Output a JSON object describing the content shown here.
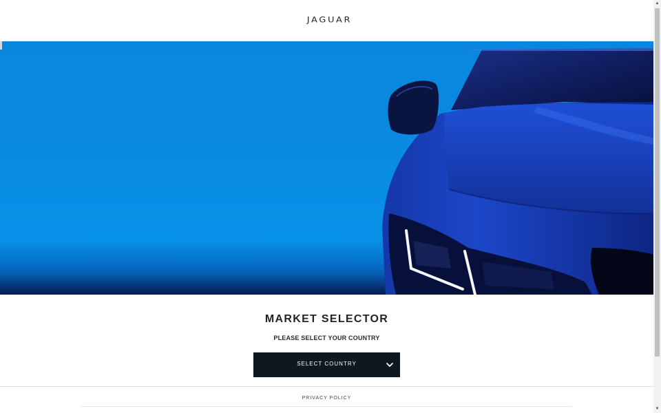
{
  "header": {
    "logo_text": "JAGUAR"
  },
  "hero": {
    "image": "blue-jaguar-car-front",
    "colors": {
      "sky": "#0a8ae2",
      "car_body": "#1a3fb8",
      "car_dark": "#0a1a5e"
    }
  },
  "market_selector": {
    "title": "MARKET SELECTOR",
    "subtitle": "PLEASE SELECT YOUR COUNTRY",
    "select_label": "SELECT COUNTRY",
    "select_icon": "chevron-down-icon",
    "button_color": "#0f1721"
  },
  "footer": {
    "privacy_label": "PRIVACY POLICY"
  },
  "scrollbar": {
    "up_icon": "scroll-up-arrow-icon",
    "down_icon": "scroll-down-arrow-icon"
  }
}
